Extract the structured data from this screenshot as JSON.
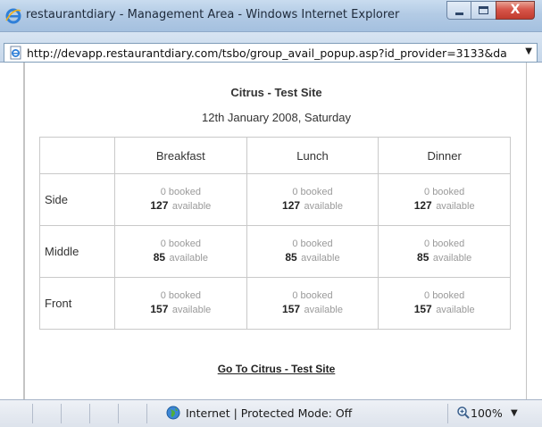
{
  "window": {
    "title": "restaurantdiary - Management Area - Windows Internet Explorer",
    "close_glyph": "X"
  },
  "address": {
    "url": "http://devapp.restaurantdiary.com/tsbo/group_avail_popup.asp?id_provider=3133&da"
  },
  "page": {
    "site_title": "Citrus - Test Site",
    "date_line": "12th January 2008, Saturday",
    "goto_link": "Go To Citrus - Test Site"
  },
  "table": {
    "columns": [
      "Breakfast",
      "Lunch",
      "Dinner"
    ],
    "rows": [
      {
        "label": "Side",
        "cells": [
          {
            "booked": "0 booked",
            "available": "127",
            "available_label": "available"
          },
          {
            "booked": "0 booked",
            "available": "127",
            "available_label": "available"
          },
          {
            "booked": "0 booked",
            "available": "127",
            "available_label": "available"
          }
        ]
      },
      {
        "label": "Middle",
        "cells": [
          {
            "booked": "0 booked",
            "available": "85",
            "available_label": "available"
          },
          {
            "booked": "0 booked",
            "available": "85",
            "available_label": "available"
          },
          {
            "booked": "0 booked",
            "available": "85",
            "available_label": "available"
          }
        ]
      },
      {
        "label": "Front",
        "cells": [
          {
            "booked": "0 booked",
            "available": "157",
            "available_label": "available"
          },
          {
            "booked": "0 booked",
            "available": "157",
            "available_label": "available"
          },
          {
            "booked": "0 booked",
            "available": "157",
            "available_label": "available"
          }
        ]
      }
    ]
  },
  "status": {
    "zone": "Internet | Protected Mode: Off",
    "zoom": "100%"
  },
  "icons": {
    "window": "internet-explorer-icon",
    "page": "page-icon",
    "zone": "globe-icon",
    "zoom": "magnifier-icon"
  }
}
